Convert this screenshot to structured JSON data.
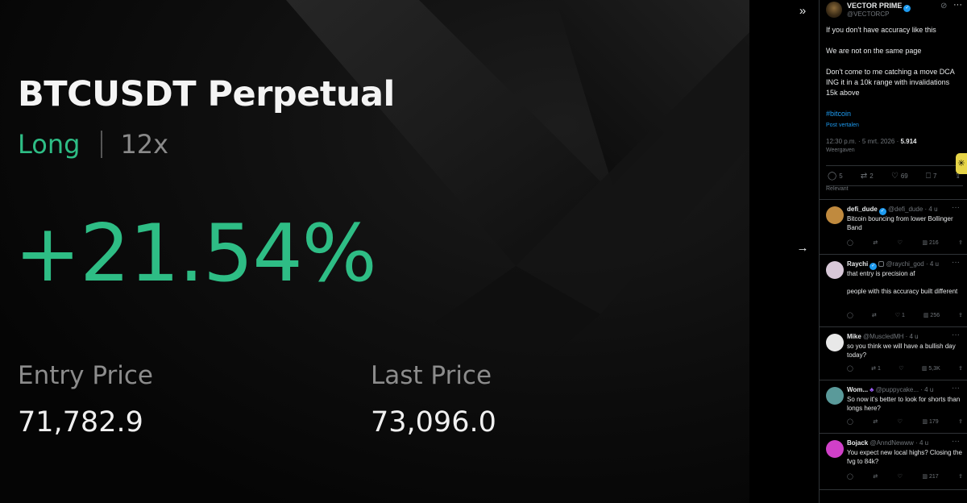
{
  "media": {
    "pair": "BTCUSDT Perpetual",
    "side": "Long",
    "leverage": "12x",
    "pnl_percent": "+21.54%",
    "entry_price_label": "Entry Price",
    "entry_price": "71,782.9",
    "last_price_label": "Last Price",
    "last_price": "73,096.0",
    "accent_color": "#2ebd85"
  },
  "controls": {
    "collapse_icon": "double-chevron-right-icon",
    "next_icon": "arrow-right-icon"
  },
  "tweet": {
    "author_name": "VECTOR PRIME",
    "author_handle": "@VECTORCP",
    "lines": [
      "If you don't have accuracy like this",
      "We are not on the same page",
      "Don't come to me catching a move DCA ING it in a 10k range with invalidations 15k above"
    ],
    "hashtag": "#bitcoin",
    "translate": "Post vertalen",
    "time": "12:30 p.m. · 5 mrt. 2026 · ",
    "views_count": "5.914",
    "views_label": "Weergaven",
    "replies": "5",
    "reposts": "2",
    "likes": "69",
    "bookmarks": "7",
    "sort_label": "Relevant"
  },
  "replies": [
    {
      "name": "defi_dude",
      "handle": "@defi_dude · 4 u",
      "text": "Bitcoin bouncing from lower Bollinger Band",
      "reposts": "",
      "likes": "",
      "views": "216",
      "avatar_color": "#c08a3e"
    },
    {
      "name": "Raychi",
      "handle": "@raychi_god · 4 u",
      "text": "that entry is precision af\n\npeople with this accuracy built different",
      "reposts": "",
      "likes": "1",
      "views": "256",
      "avatar_color": "#d8c8d8"
    },
    {
      "name": "Mike",
      "handle": "@MuscledMH · 4 u",
      "text": "so you think we will have a bullish day today?",
      "reposts": "1",
      "likes": "",
      "views": "5,3K",
      "avatar_color": "#e8e8e8"
    },
    {
      "name": "Wom...",
      "handle": "@puppycake... · 4 u",
      "text": "So now it's better to look for shorts than longs here?",
      "reposts": "",
      "likes": "",
      "views": "179",
      "avatar_color": "#5a9a9a"
    },
    {
      "name": "Bojack",
      "handle": "@AnndNewww · 4 u",
      "text": "You expect new local highs? Closing the fvg to 84k?",
      "reposts": "",
      "likes": "",
      "views": "217",
      "avatar_color": "#d040c8"
    }
  ]
}
